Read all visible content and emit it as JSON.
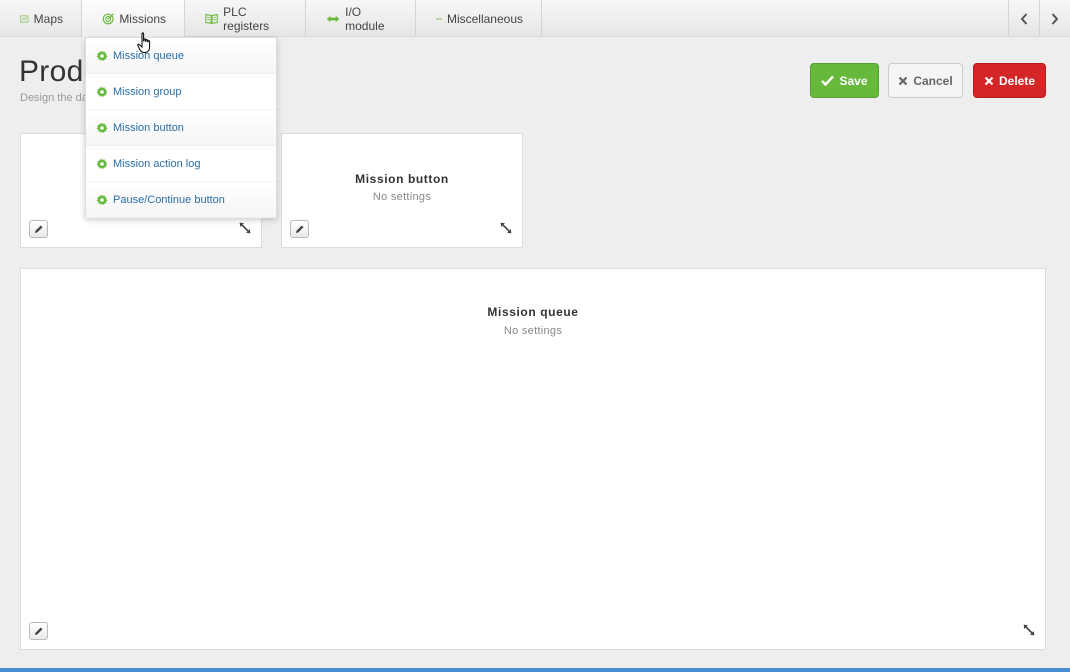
{
  "nav": {
    "tabs": [
      {
        "label": "Maps"
      },
      {
        "label": "Missions"
      },
      {
        "label": "PLC registers"
      },
      {
        "label": "I/O module"
      },
      {
        "label": "Miscellaneous"
      }
    ]
  },
  "header": {
    "title": "Produ",
    "subtitle": "Design the da"
  },
  "actions": {
    "save": "Save",
    "cancel": "Cancel",
    "delete": "Delete"
  },
  "missions_menu": {
    "items": [
      {
        "label": "Mission queue"
      },
      {
        "label": "Mission group"
      },
      {
        "label": "Mission button"
      },
      {
        "label": "Mission action log"
      },
      {
        "label": "Pause/Continue button"
      }
    ]
  },
  "widgets": [
    {
      "title": "",
      "subtitle": ""
    },
    {
      "title": "Mission button",
      "subtitle": "No settings"
    },
    {
      "title": "Mission queue",
      "subtitle": "No settings"
    }
  ],
  "colors": {
    "accent_green": "#66b93b",
    "danger_red": "#d42626",
    "link_blue": "#2b6ea5"
  }
}
